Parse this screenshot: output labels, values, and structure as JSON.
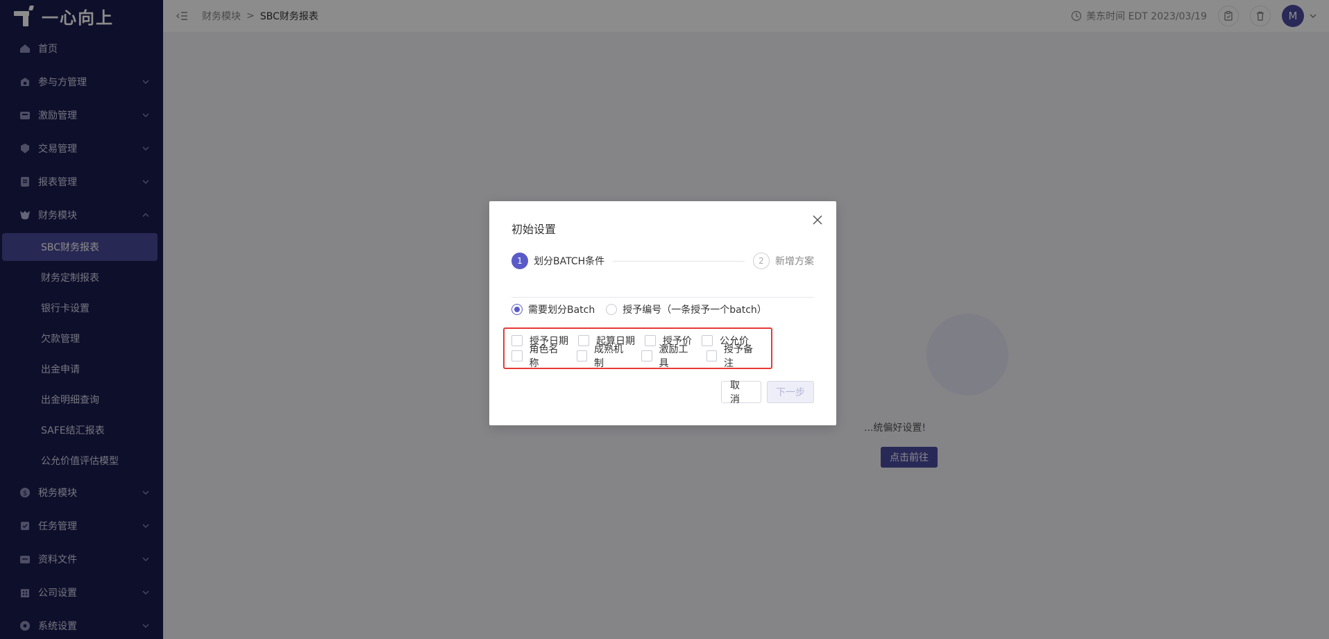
{
  "app": {
    "logo_text": "一心向上"
  },
  "sidebar": {
    "items": [
      {
        "label": "首页",
        "icon": "home-icon",
        "expandable": false
      },
      {
        "label": "参与方管理",
        "icon": "participants-icon",
        "expandable": true
      },
      {
        "label": "激励管理",
        "icon": "incentive-icon",
        "expandable": true
      },
      {
        "label": "交易管理",
        "icon": "trade-icon",
        "expandable": true
      },
      {
        "label": "报表管理",
        "icon": "report-icon",
        "expandable": true
      },
      {
        "label": "财务模块",
        "icon": "finance-icon",
        "expandable": true,
        "expanded": true
      }
    ],
    "finance_sub": [
      {
        "label": "SBC财务报表",
        "active": true
      },
      {
        "label": "财务定制报表"
      },
      {
        "label": "银行卡设置"
      },
      {
        "label": "欠款管理"
      },
      {
        "label": "出金申请"
      },
      {
        "label": "出金明细查询"
      },
      {
        "label": "SAFE结汇报表"
      },
      {
        "label": "公允价值评估模型"
      }
    ],
    "items_after": [
      {
        "label": "税务模块",
        "icon": "tax-icon"
      },
      {
        "label": "任务管理",
        "icon": "task-icon"
      },
      {
        "label": "资料文件",
        "icon": "files-icon"
      },
      {
        "label": "公司设置",
        "icon": "company-icon"
      },
      {
        "label": "系统设置",
        "icon": "system-icon"
      }
    ]
  },
  "header": {
    "breadcrumb": [
      "财务模块",
      "SBC财务报表"
    ],
    "time_text": "美东时间 EDT 2023/03/19",
    "avatar_letter": "M"
  },
  "main": {
    "empty_text": "...统偏好设置!",
    "go_button": "点击前往"
  },
  "modal": {
    "title": "初始设置",
    "steps": [
      {
        "num": "1",
        "label": "划分BATCH条件",
        "active": true
      },
      {
        "num": "2",
        "label": "新增方案",
        "active": false
      }
    ],
    "radios": [
      {
        "label": "需要划分Batch",
        "checked": true
      },
      {
        "label": "授予编号（一条授予一个batch）",
        "checked": false
      }
    ],
    "checkbox_rows": [
      [
        "授予日期",
        "起算日期",
        "授予价",
        "公允价"
      ],
      [
        "角色名称",
        "成熟机制",
        "激励工具",
        "授予备注"
      ]
    ],
    "cancel_label": "取 消",
    "next_label": "下一步"
  },
  "colors": {
    "sidebar_bg": "#1b1c4f",
    "accent": "#5a5ac8",
    "highlight_border": "#e53935"
  }
}
